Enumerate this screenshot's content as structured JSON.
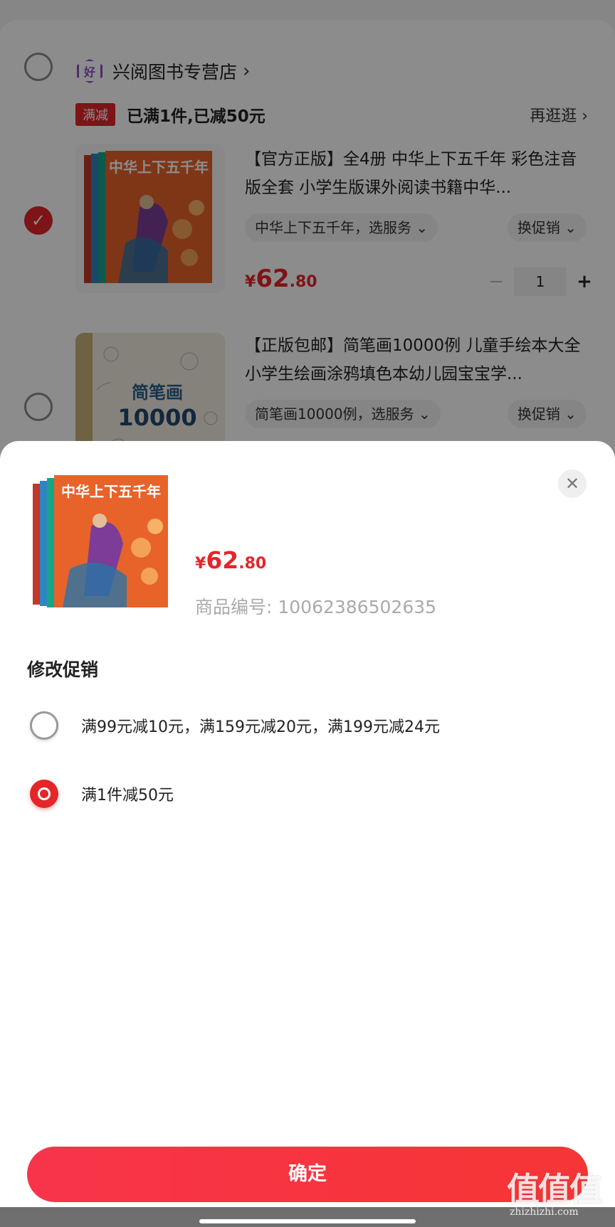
{
  "cart": {
    "shop": {
      "badge": "好",
      "name": "兴阅图书专营店",
      "chevron": "›"
    },
    "promo": {
      "tag": "满减",
      "text": "已满1件,已减50元",
      "more": "再逛逛 ›"
    },
    "items": [
      {
        "title": "【官方正版】全4册 中华上下五千年 彩色注音版全套 小学生版课外阅读书籍中华...",
        "spec": "中华上下五千年，选服务 ⌄",
        "promo_btn": "换促销 ⌄",
        "price_symbol": "¥",
        "price_int": "62",
        "price_dec": ".80",
        "quantity": "1",
        "minus": "−",
        "plus": "+",
        "checked": true,
        "cover_text": "中华上下五千年"
      },
      {
        "title": "【正版包邮】简笔画10000例 儿童手绘本大全小学生绘画涂鸦填色本幼儿园宝宝学...",
        "spec": "简笔画10000例，选服务 ⌄",
        "promo_btn": "换促销 ⌄",
        "checked": false,
        "cover_text": "简笔画",
        "cover_number": "10000"
      }
    ]
  },
  "sheet": {
    "close": "✕",
    "price_symbol": "¥",
    "price_int": "62",
    "price_dec": ".80",
    "sku": "商品编号: 10062386502635",
    "section_title": "修改促销",
    "options": [
      {
        "label": "满99元减10元，满159元减20元，满199元减24元",
        "selected": false
      },
      {
        "label": "满1件减50元",
        "selected": true
      }
    ],
    "confirm": "确定",
    "cover_text": "中华上下五千年"
  },
  "watermark": {
    "big": "值值值",
    "small": "zhizhizhi.com"
  },
  "colors": {
    "accent": "#e4262b",
    "shop_badge": "#8e4fd1",
    "button_gradient_start": "#f8344a",
    "button_gradient_end": "#f63535"
  },
  "icons": [
    "shop-badge-icon",
    "chevron-right-icon",
    "check-icon",
    "chevron-down-icon",
    "close-icon",
    "radio-icon"
  ]
}
